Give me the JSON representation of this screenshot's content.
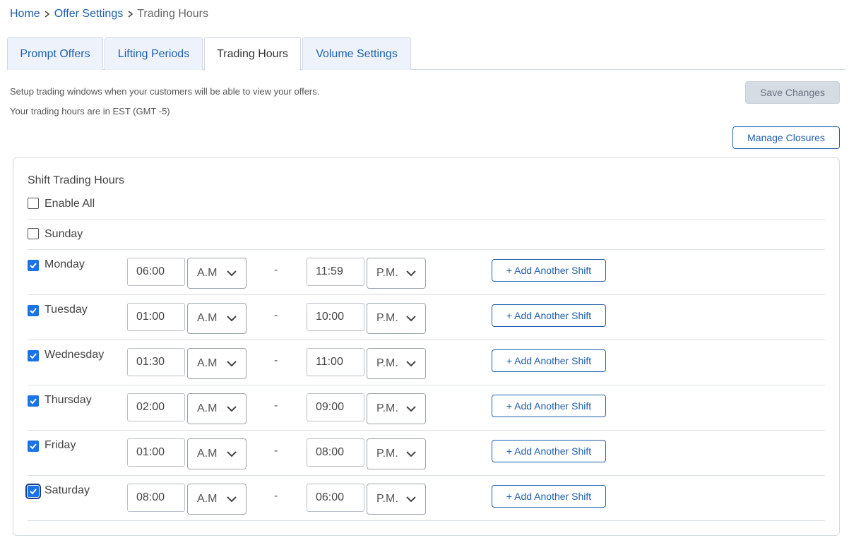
{
  "breadcrumb": {
    "home": "Home",
    "offer_settings": "Offer Settings",
    "current": "Trading Hours"
  },
  "tabs": [
    {
      "label": "Prompt Offers",
      "active": false
    },
    {
      "label": "Lifting Periods",
      "active": false
    },
    {
      "label": "Trading Hours",
      "active": true
    },
    {
      "label": "Volume Settings",
      "active": false
    }
  ],
  "description": {
    "line1": "Setup trading windows when your customers will be able to view your offers.",
    "line2": "Your trading hours are in EST (GMT -5)"
  },
  "buttons": {
    "save": "Save Changes",
    "manage_closures": "Manage Closures",
    "add_shift": "+ Add Another Shift"
  },
  "panel": {
    "title": "Shift Trading Hours",
    "enable_all_label": "Enable All",
    "enable_all_checked": false
  },
  "days": [
    {
      "label": "Sunday",
      "checked": false
    },
    {
      "label": "Monday",
      "checked": true,
      "start": "06:00",
      "start_period": "A.M",
      "end": "11:59",
      "end_period": "P.M."
    },
    {
      "label": "Tuesday",
      "checked": true,
      "start": "01:00",
      "start_period": "A.M",
      "end": "10:00",
      "end_period": "P.M."
    },
    {
      "label": "Wednesday",
      "checked": true,
      "start": "01:30",
      "start_period": "A.M",
      "end": "11:00",
      "end_period": "P.M."
    },
    {
      "label": "Thursday",
      "checked": true,
      "start": "02:00",
      "start_period": "A.M",
      "end": "09:00",
      "end_period": "P.M."
    },
    {
      "label": "Friday",
      "checked": true,
      "start": "01:00",
      "start_period": "A.M",
      "end": "08:00",
      "end_period": "P.M."
    },
    {
      "label": "Saturday",
      "checked": true,
      "start": "08:00",
      "start_period": "A.M",
      "end": "06:00",
      "end_period": "P.M.",
      "focused": true
    }
  ],
  "separator": "-",
  "colors": {
    "accent": "#1f5fad",
    "checkbox_checked": "#1a73e8",
    "tab_inactive_bg": "#eef3fb",
    "save_disabled_bg": "#d6dce4"
  },
  "icons": {
    "breadcrumb_separator": "chevron-right-icon",
    "dropdown": "chevron-down-icon",
    "checkbox": "checkmark-icon"
  }
}
